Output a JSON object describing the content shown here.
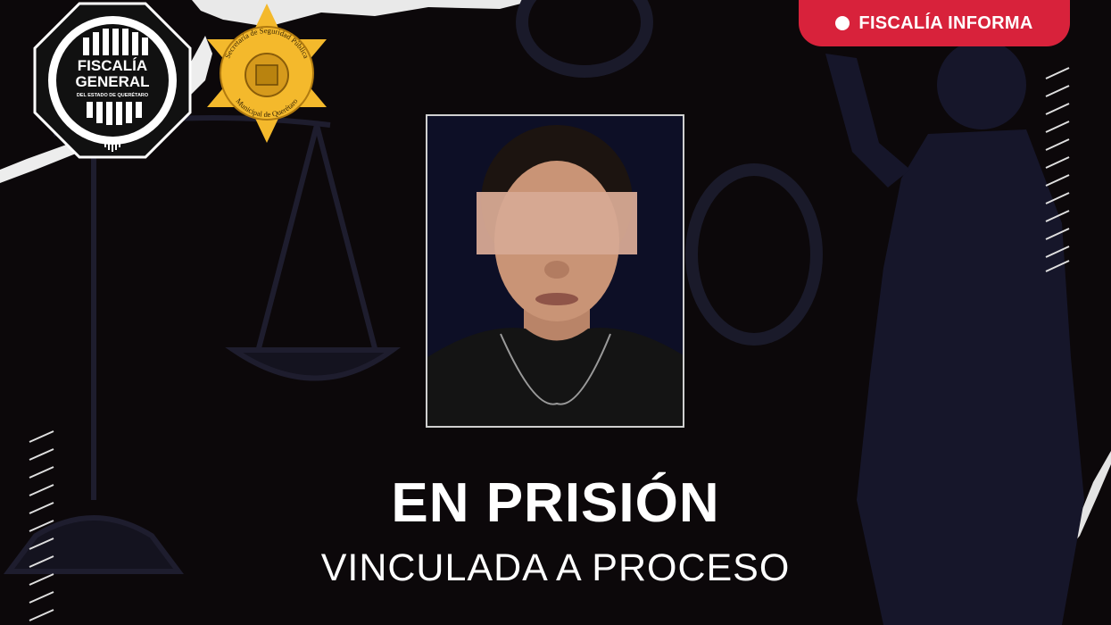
{
  "badge": {
    "label": "FISCALÍA INFORMA"
  },
  "headline": "EN PRISIÓN",
  "subheadline": "VINCULADA A PROCESO",
  "logos": {
    "fiscalia_line1": "FISCALÍA",
    "fiscalia_line2": "GENERAL",
    "fiscalia_line3": "DEL ESTADO DE QUERÉTARO",
    "star_arc_top": "Secretaría de Seguridad Pública",
    "star_arc_bottom": "Municipal de Querétaro"
  },
  "colors": {
    "background": "#0c080a",
    "badge": "#d8223b",
    "star_gold": "#f4b92c",
    "text": "#ffffff"
  },
  "icons": {
    "badge_marker": "circle-dot-icon",
    "scale": "justice-scale-icon",
    "statue": "lady-justice-icon",
    "handcuffs": "handcuffs-icon"
  }
}
